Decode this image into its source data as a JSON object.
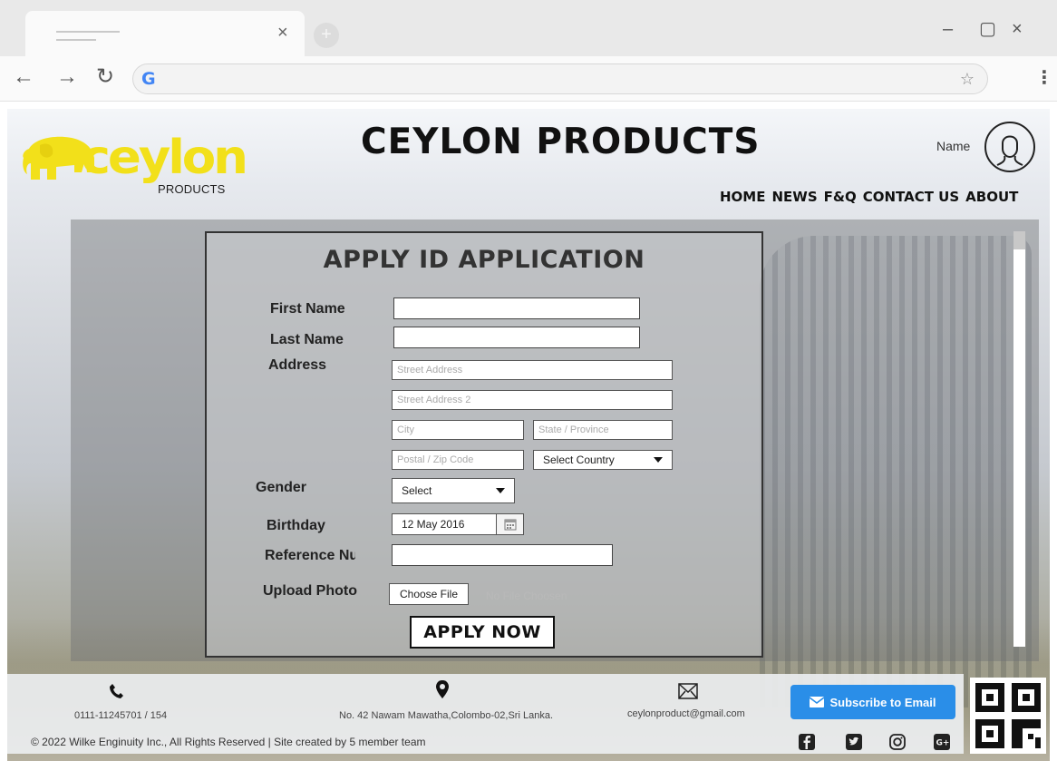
{
  "browser": {
    "tab_close_glyph": "×",
    "window_controls": [
      "–",
      "▢",
      "×"
    ],
    "nav_back": "←",
    "nav_forward": "→",
    "nav_reload": "↻",
    "google_glyph": "G",
    "star_glyph": "☆",
    "menu_glyph": "⋮"
  },
  "header": {
    "logo_word": "ceylon",
    "logo_sub": "PRODUCTS",
    "title": "CEYLON PRODUCTS",
    "user_name": "Name",
    "nav": [
      "HOME",
      "NEWS",
      "F&Q",
      "CONTACT US",
      "ABOUT"
    ]
  },
  "form": {
    "title": "APPLY ID APPLICATION",
    "labels": {
      "first_name": "First Name",
      "last_name": "Last Name",
      "address": "Address",
      "gender": "Gender",
      "birthday": "Birthday",
      "reference": "Reference Number",
      "upload_photo": "Upload Photo"
    },
    "placeholders": {
      "street1": "Street Address",
      "street2": "Street Address 2",
      "city": "City",
      "state": "State / Province",
      "postal": "Postal / Zip Code"
    },
    "country_select": "Select Country",
    "gender_select": "Select",
    "birthday_value": "12 May 2016",
    "choose_file": "Choose File",
    "no_file": "No File Choosen",
    "submit": "APPLY NOW"
  },
  "footer": {
    "phone": "0111-11245701 / 154",
    "address": "No. 42 Nawam Mawatha,Colombo-02,Sri Lanka.",
    "email": "ceylonproduct@gmail.com",
    "subscribe": "Subscribe to Email",
    "copyright": "© 2022 Wilke Enginuity Inc., All Rights Reserved | Site created by 5 member team"
  },
  "colors": {
    "logo_yellow": "#f2e01a",
    "subscribe_blue": "#2a8ee8"
  }
}
